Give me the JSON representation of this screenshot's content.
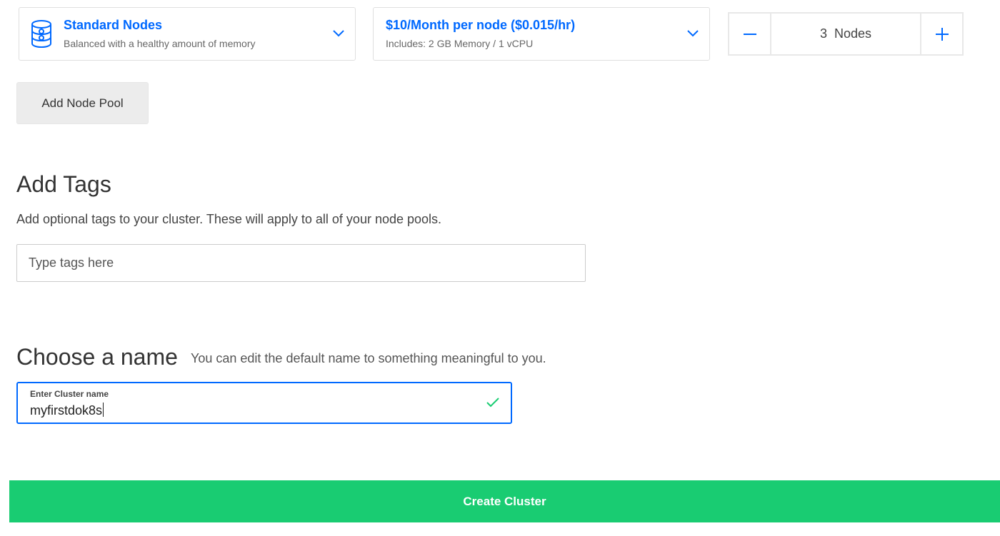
{
  "node_type": {
    "title": "Standard Nodes",
    "subtitle": "Balanced with a healthy amount of memory",
    "icon": "database-icon"
  },
  "node_plan": {
    "title": "$10/Month per node ($0.015/hr)",
    "subtitle": "Includes: 2 GB Memory / 1 vCPU"
  },
  "node_count": {
    "value": 3,
    "display": "3  Nodes",
    "decrement_icon": "minus-icon",
    "increment_icon": "plus-icon"
  },
  "add_node_pool": {
    "label": "Add Node Pool"
  },
  "tags": {
    "heading": "Add Tags",
    "description": "Add optional tags to your cluster. These will apply to all of your node pools.",
    "placeholder": "Type tags here",
    "value": ""
  },
  "cluster_name": {
    "heading": "Choose a name",
    "hint": "You can edit the default name to something meaningful to you.",
    "field_label": "Enter Cluster name",
    "value": "myfirstdok8s",
    "valid_icon": "checkmark-icon"
  },
  "create_button": {
    "label": "Create Cluster"
  },
  "colors": {
    "accent_blue": "#0069ff",
    "create_green": "#19cc72",
    "valid_green": "#19cc72"
  }
}
